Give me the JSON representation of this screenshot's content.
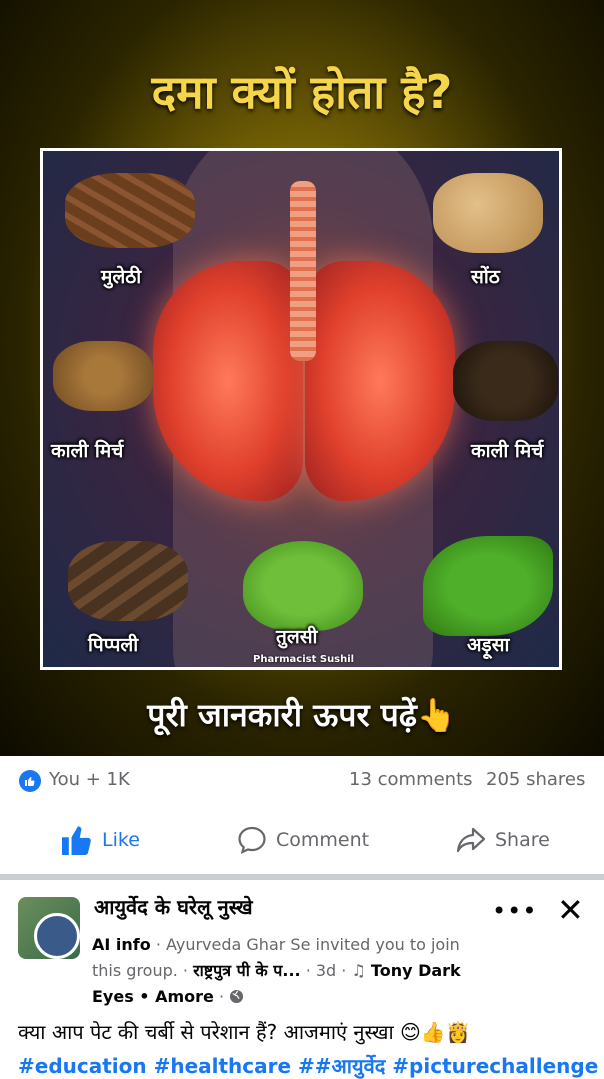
{
  "post_image": {
    "headline": "दमा क्यों होता है?",
    "labels": {
      "top_left": "मुलेठी",
      "top_right": "सोंठ",
      "mid_left": "काली मिर्च",
      "mid_right": "काली मिर्च",
      "bottom_left": "पिप्पली",
      "bottom_center": "तुलसी",
      "bottom_right": "अड़ूसा"
    },
    "credit": "Pharmacist Sushil",
    "cta": "पूरी जानकारी ऊपर पढ़ें👆"
  },
  "stats": {
    "reactors": "You + 1K",
    "comments": "13 comments",
    "shares": "205 shares"
  },
  "actions": {
    "like": "Like",
    "comment": "Comment",
    "share": "Share"
  },
  "next_post": {
    "group_name": "आयुर्वेद के घरेलू नुस्खे",
    "author_tag": "AI info",
    "invite_text": " · Ayurveda Ghar Se invited you to join this group. · ",
    "source_name": "राष्ट्रपुत्र पी के प...",
    "age": " · 3d · ",
    "music_icon": "music-note-icon",
    "music_title": "Tony Dark Eyes • Amore",
    "privacy_icon": "globe-icon",
    "text": "क्या आप पेट की चर्बी से परेशान हैं? आजमाएं नुस्खा 😊👍👸",
    "hashtags": "#education #healthcare ##आयुर्वेद #picturechallenge"
  },
  "colors": {
    "brand_blue": "#1877f2",
    "headline_gold": "#f5d64a",
    "muted_text": "#65676b"
  }
}
